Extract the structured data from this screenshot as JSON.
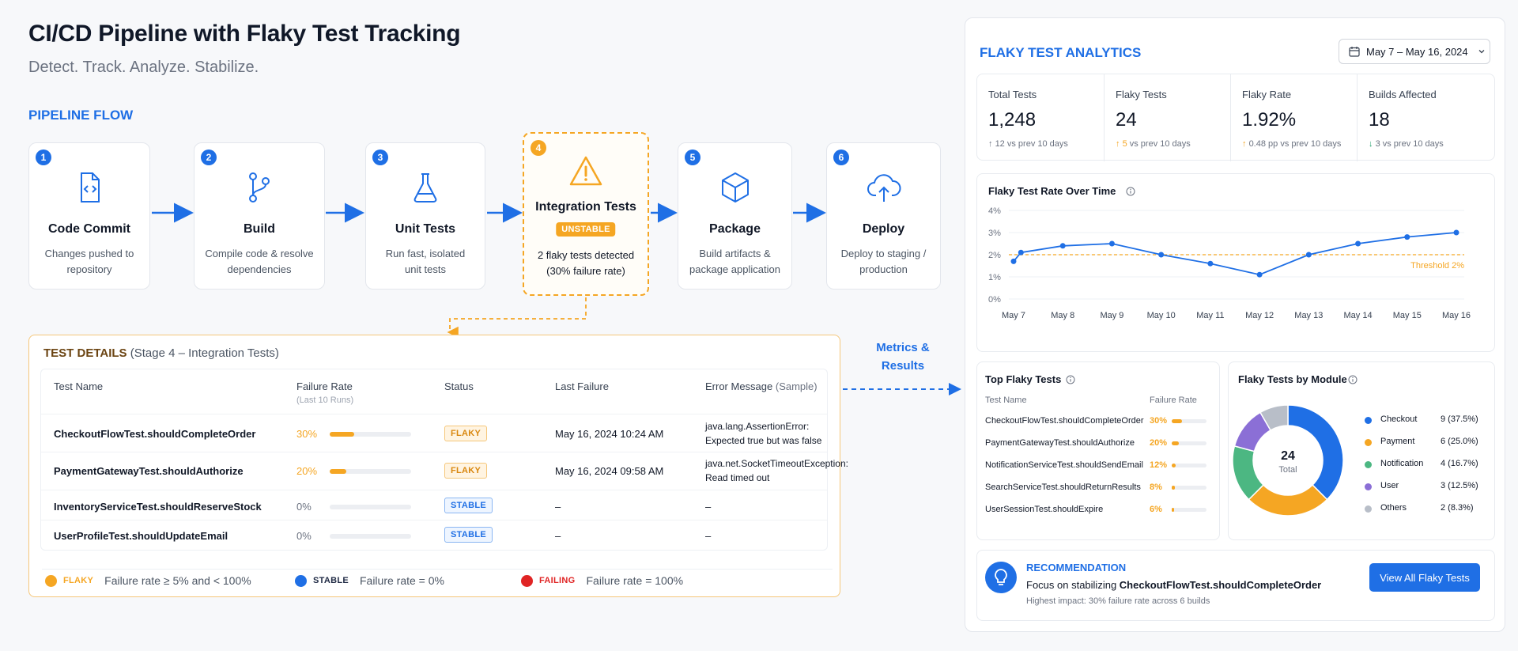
{
  "header": {
    "title": "CI/CD Pipeline with Flaky Test Tracking",
    "subtitle": "Detect. Track. Analyze. Stabilize.",
    "pipeline_label": "PIPELINE FLOW"
  },
  "stages": [
    {
      "num": "1",
      "name": "Code Commit",
      "desc": "Changes pushed to repository",
      "icon": "code-file-icon"
    },
    {
      "num": "2",
      "name": "Build",
      "desc": "Compile code & resolve dependencies",
      "icon": "git-branch-icon"
    },
    {
      "num": "3",
      "name": "Unit Tests",
      "desc": "Run fast, isolated unit tests",
      "icon": "flask-icon"
    },
    {
      "num": "4",
      "name": "Integration Tests",
      "badge": "UNSTABLE",
      "desc": "2 flaky tests detected (30% failure rate)",
      "icon": "warning-icon"
    },
    {
      "num": "5",
      "name": "Package",
      "desc": "Build artifacts & package application",
      "icon": "package-box-icon"
    },
    {
      "num": "6",
      "name": "Deploy",
      "desc": "Deploy to staging / production",
      "icon": "cloud-upload-icon"
    }
  ],
  "details": {
    "title_bold": "TEST DETAILS",
    "title_rest": "(Stage 4 – Integration Tests)",
    "columns": {
      "name": "Test Name",
      "rate": "Failure Rate",
      "rate_sub": "(Last 10 Runs)",
      "status": "Status",
      "last": "Last Failure",
      "error": "Error Message",
      "error_sub": "(Sample)"
    },
    "rows": [
      {
        "name": "CheckoutFlowTest.shouldCompleteOrder",
        "rate": "30%",
        "rate_value": 0.3,
        "status": "FLAKY",
        "last": "May 16, 2024 10:24 AM",
        "err1": "java.lang.AssertionError:",
        "err2": "Expected true but was false"
      },
      {
        "name": "PaymentGatewayTest.shouldAuthorize",
        "rate": "20%",
        "rate_value": 0.2,
        "status": "FLAKY",
        "last": "May 16, 2024 09:58 AM",
        "err1": "java.net.SocketTimeoutException:",
        "err2": "Read timed out"
      },
      {
        "name": "InventoryServiceTest.shouldReserveStock",
        "rate": "0%",
        "rate_value": 0,
        "status": "STABLE",
        "last": "–",
        "err1": "–",
        "err2": ""
      },
      {
        "name": "UserProfileTest.shouldUpdateEmail",
        "rate": "0%",
        "rate_value": 0,
        "status": "STABLE",
        "last": "–",
        "err1": "–",
        "err2": ""
      }
    ],
    "legend": [
      {
        "tag": "FLAKY",
        "text": "Failure rate ≥ 5% and < 100%",
        "color": "#f5a623"
      },
      {
        "tag": "STABLE",
        "text": "Failure rate = 0%",
        "color": "#1f6fe5"
      },
      {
        "tag": "FAILING",
        "text": "Failure rate = 100%",
        "color": "#e02424"
      }
    ]
  },
  "metrics_label": {
    "line1": "Metrics &",
    "line2": "Results"
  },
  "analytics": {
    "title": "FLAKY TEST ANALYTICS",
    "date_range": "May 7 – May 16, 2024",
    "kpis": [
      {
        "label": "Total Tests",
        "value": "1,248",
        "delta": "12",
        "delta_text": "vs prev 10 days",
        "arrow": "↑",
        "color": "#6b7280"
      },
      {
        "label": "Flaky Tests",
        "value": "24",
        "delta": "5",
        "delta_text": "vs prev 10 days",
        "arrow": "↑",
        "color": "#f5a623"
      },
      {
        "label": "Flaky Rate",
        "value": "1.92%",
        "delta": "0.48 pp",
        "delta_text": "vs prev 10 days",
        "arrow": "↑",
        "color": "#f5a623"
      },
      {
        "label": "Builds Affected",
        "value": "18",
        "delta": "3",
        "delta_text": "vs prev 10 days",
        "arrow": "↓",
        "color": "#22a06b"
      }
    ],
    "trend_title": "Flaky Test Rate Over Time",
    "top_title": "Top Flaky Tests",
    "top_headers": {
      "name": "Test Name",
      "rate": "Failure Rate"
    },
    "top_tests": [
      {
        "name": "CheckoutFlowTest.shouldCompleteOrder",
        "rate": "30%",
        "value": 0.3
      },
      {
        "name": "PaymentGatewayTest.shouldAuthorize",
        "rate": "20%",
        "value": 0.2
      },
      {
        "name": "NotificationServiceTest.shouldSendEmail",
        "rate": "12%",
        "value": 0.12
      },
      {
        "name": "SearchServiceTest.shouldReturnResults",
        "rate": "8%",
        "value": 0.08
      },
      {
        "name": "UserSessionTest.shouldExpire",
        "rate": "6%",
        "value": 0.06
      }
    ],
    "module_title": "Flaky Tests by Module",
    "module_total": "24",
    "module_total_label": "Total",
    "modules": [
      {
        "name": "Checkout",
        "value": "9 (37.5%)",
        "count": 9,
        "color": "#1f6fe5"
      },
      {
        "name": "Payment",
        "value": "6 (25.0%)",
        "count": 6,
        "color": "#f5a623"
      },
      {
        "name": "Notification",
        "value": "4 (16.7%)",
        "count": 4,
        "color": "#4cb782"
      },
      {
        "name": "User",
        "value": "3 (12.5%)",
        "count": 3,
        "color": "#8b6fd6"
      },
      {
        "name": "Others",
        "value": "2 (8.3%)",
        "count": 2,
        "color": "#b8bec8"
      }
    ],
    "recommendation": {
      "title": "RECOMMENDATION",
      "text_prefix": "Focus on stabilizing ",
      "text_bold": "CheckoutFlowTest.shouldCompleteOrder",
      "sub": "Highest impact: 30% failure rate across 6 builds",
      "button": "View All Flaky Tests"
    }
  },
  "chart_data": {
    "type": "line",
    "title": "Flaky Test Rate Over Time",
    "categories": [
      "May 7",
      "May 8",
      "May 9",
      "May 10",
      "May 11",
      "May 12",
      "May 13",
      "May 14",
      "May 15",
      "May 16"
    ],
    "x_points": [
      "May 7",
      "",
      "May 8",
      "May 9",
      "May 10",
      "May 11",
      "May 12",
      "May 13",
      "May 14",
      "May 15",
      "May 16"
    ],
    "x_index": [
      0,
      0.15,
      1,
      2,
      3,
      4,
      5,
      6,
      7,
      8,
      9
    ],
    "values": [
      1.7,
      2.1,
      2.4,
      2.5,
      2.0,
      1.6,
      1.1,
      2.0,
      2.5,
      2.8,
      3.0
    ],
    "ylim": [
      0,
      4
    ],
    "yticks": [
      "0%",
      "1%",
      "2%",
      "3%",
      "4%"
    ],
    "threshold": 2,
    "threshold_label": "Threshold 2%",
    "grid": true,
    "colors": {
      "line": "#1f6fe5",
      "threshold": "#f5a623"
    }
  }
}
